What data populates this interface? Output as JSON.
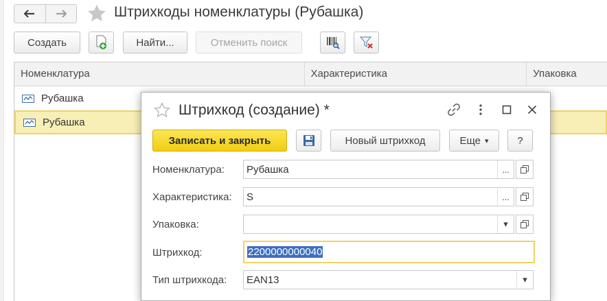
{
  "main": {
    "title": "Штрихкоды номенклатуры (Рубашка)",
    "toolbar": {
      "create_label": "Создать",
      "find_label": "Найти...",
      "cancel_search_label": "Отменить поиск"
    }
  },
  "table": {
    "columns": [
      "Номенклатура",
      "Характеристика",
      "Упаковка"
    ],
    "rows": [
      {
        "nomenclature": "Рубашка"
      },
      {
        "nomenclature": "Рубашка"
      }
    ]
  },
  "dialog": {
    "title": "Штрихкод (создание) *",
    "buttons": {
      "save_close": "Записать и закрыть",
      "new_barcode": "Новый штрихкод",
      "more": "Еще",
      "help": "?"
    },
    "fields": {
      "nomenclature_label": "Номенклатура:",
      "nomenclature_value": "Рубашка",
      "characteristic_label": "Характеристика:",
      "characteristic_value": "S",
      "package_label": "Упаковка:",
      "package_value": "",
      "barcode_label": "Штрихкод:",
      "barcode_value": "2200000000040",
      "barcode_type_label": "Тип штрихкода:",
      "barcode_type_value": "EAN13"
    },
    "more_button": "...",
    "dropdown_arrow": "▾"
  },
  "colors": {
    "accent_yellow": "#f1cd13",
    "selection_row": "#f8efb6",
    "selection_border": "#f0d263",
    "text_selection": "#3d6fbf"
  }
}
